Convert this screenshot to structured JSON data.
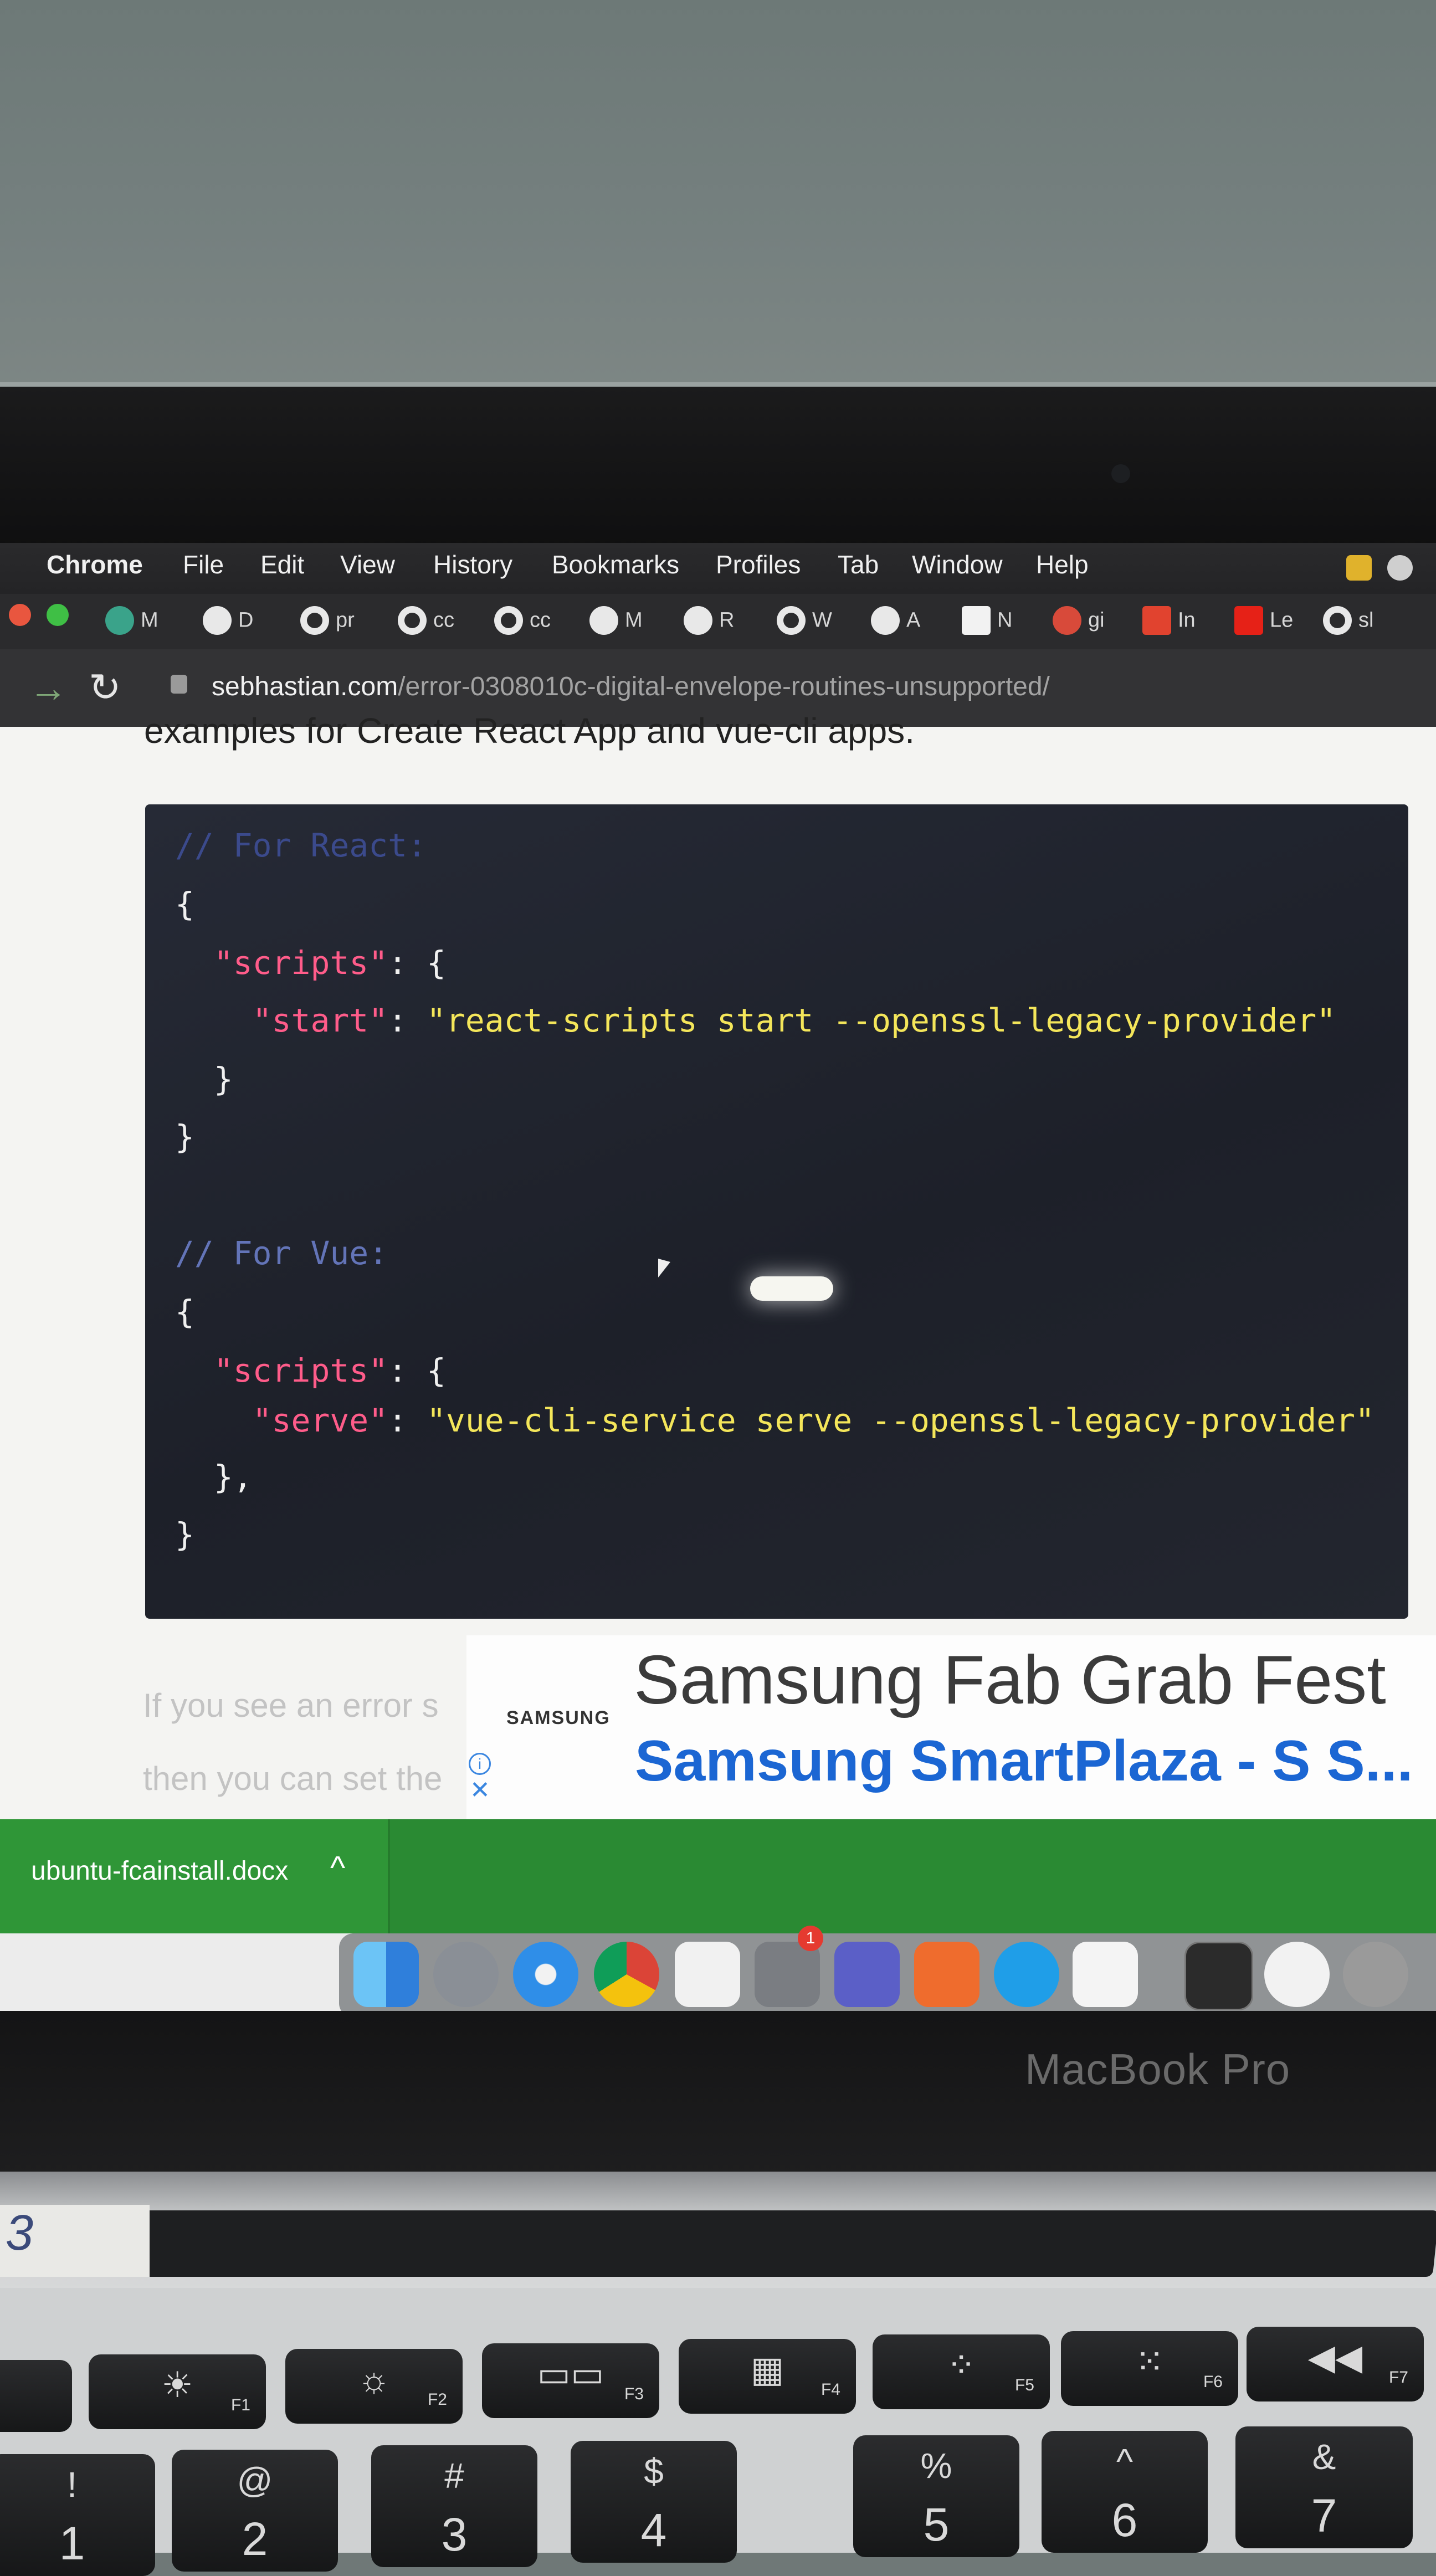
{
  "device": {
    "label": "MacBook Pro"
  },
  "menubar": {
    "app": "Chrome",
    "items": [
      "File",
      "Edit",
      "View",
      "History",
      "Bookmarks",
      "Profiles",
      "Tab",
      "Window",
      "Help"
    ]
  },
  "bookmarks": [
    {
      "icon": "openai-icon",
      "label": "M"
    },
    {
      "icon": "globe-icon",
      "label": "D"
    },
    {
      "icon": "github-icon",
      "label": "pr"
    },
    {
      "icon": "github-icon",
      "label": "cc"
    },
    {
      "icon": "github-icon",
      "label": "cc"
    },
    {
      "icon": "globe-icon",
      "label": "M"
    },
    {
      "icon": "globe-icon",
      "label": "R"
    },
    {
      "icon": "github-icon",
      "label": "W"
    },
    {
      "icon": "globe-icon",
      "label": "A"
    },
    {
      "icon": "site-icon",
      "label": "N"
    },
    {
      "icon": "globe-icon",
      "label": "gi"
    },
    {
      "icon": "site-icon",
      "label": "In"
    },
    {
      "icon": "youtube-icon",
      "label": "Le"
    },
    {
      "icon": "github-icon",
      "label": "sl"
    }
  ],
  "address": {
    "domain": "sebhastian.com",
    "path": "/error-0308010c-digital-envelope-routines-unsupported/"
  },
  "article": {
    "partial_line": "examples for Create React App and vue-cli apps.",
    "para_line1": "If you see an error s",
    "para_line2": "then you can set the"
  },
  "code": {
    "comment_react": "// For React:",
    "open_brace": "{",
    "scripts_key": "\"scripts\"",
    "colon_brace": ": {",
    "start_key": "\"start\"",
    "colon": ": ",
    "start_value": "\"react-scripts start --openssl-legacy-provider\"",
    "close_inner": "}",
    "close_inner_comma": "},",
    "close_outer": "}",
    "comment_vue": "// For Vue:",
    "serve_key": "\"serve\"",
    "serve_value": "\"vue-cli-service serve --openssl-legacy-provider\""
  },
  "ad": {
    "brand": "SAMSUNG",
    "title": "Samsung Fab Grab Fest",
    "subtitle": "Samsung SmartPlaza - S S...",
    "info_glyph": "i",
    "close_glyph": "✕"
  },
  "downloads": {
    "file": "ubuntu-fcainstall.docx",
    "chevron": "^"
  },
  "dock": {
    "apps": [
      "finder-icon",
      "launchpad-icon",
      "safari-icon",
      "chrome-icon",
      "reminders-icon",
      "system-settings-icon",
      "teams-icon",
      "postman-icon",
      "skype-icon",
      "vscode-icon",
      "terminal-icon",
      "music-icon",
      "keychain-icon"
    ],
    "settings_badge": "1",
    "colors": {
      "finder": "#3a8ee6",
      "launchpad": "#8a8f96",
      "safari": "#2f8ee8",
      "chrome": "#e8e8e8",
      "reminders": "#f1f1f1",
      "settings": "#7a7d82",
      "teams": "#5b5fc7",
      "postman": "#ef6c2d",
      "skype": "#1f9ee8",
      "vscode": "#f4f4f4",
      "terminal": "#2b2b2b",
      "music": "#f2f2f2",
      "keychain": "#9a9a9a"
    }
  },
  "keyboard": {
    "fn_keys": [
      "F1",
      "F2",
      "F3",
      "F4",
      "F5",
      "F6",
      "F7"
    ],
    "number_keys": [
      {
        "top": "!",
        "bottom": "1"
      },
      {
        "top": "@",
        "bottom": "2"
      },
      {
        "top": "#",
        "bottom": "3"
      },
      {
        "top": "$",
        "bottom": "4"
      },
      {
        "top": "%",
        "bottom": "5"
      },
      {
        "top": "^",
        "bottom": "6"
      },
      {
        "top": "&",
        "bottom": "7"
      }
    ]
  },
  "sticker": "3"
}
